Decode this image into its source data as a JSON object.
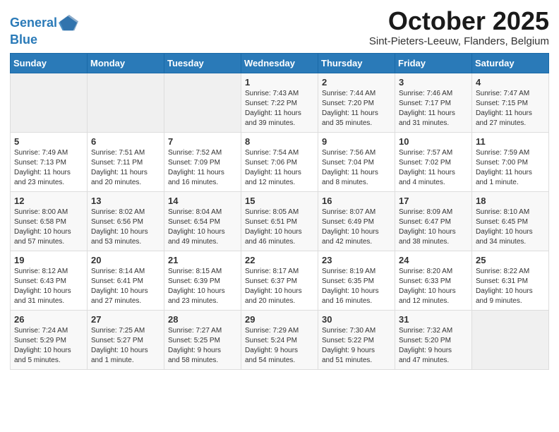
{
  "header": {
    "logo_line1": "General",
    "logo_line2": "Blue",
    "month": "October 2025",
    "location": "Sint-Pieters-Leeuw, Flanders, Belgium"
  },
  "days_of_week": [
    "Sunday",
    "Monday",
    "Tuesday",
    "Wednesday",
    "Thursday",
    "Friday",
    "Saturday"
  ],
  "weeks": [
    [
      {
        "day": "",
        "info": ""
      },
      {
        "day": "",
        "info": ""
      },
      {
        "day": "",
        "info": ""
      },
      {
        "day": "1",
        "info": "Sunrise: 7:43 AM\nSunset: 7:22 PM\nDaylight: 11 hours\nand 39 minutes."
      },
      {
        "day": "2",
        "info": "Sunrise: 7:44 AM\nSunset: 7:20 PM\nDaylight: 11 hours\nand 35 minutes."
      },
      {
        "day": "3",
        "info": "Sunrise: 7:46 AM\nSunset: 7:17 PM\nDaylight: 11 hours\nand 31 minutes."
      },
      {
        "day": "4",
        "info": "Sunrise: 7:47 AM\nSunset: 7:15 PM\nDaylight: 11 hours\nand 27 minutes."
      }
    ],
    [
      {
        "day": "5",
        "info": "Sunrise: 7:49 AM\nSunset: 7:13 PM\nDaylight: 11 hours\nand 23 minutes."
      },
      {
        "day": "6",
        "info": "Sunrise: 7:51 AM\nSunset: 7:11 PM\nDaylight: 11 hours\nand 20 minutes."
      },
      {
        "day": "7",
        "info": "Sunrise: 7:52 AM\nSunset: 7:09 PM\nDaylight: 11 hours\nand 16 minutes."
      },
      {
        "day": "8",
        "info": "Sunrise: 7:54 AM\nSunset: 7:06 PM\nDaylight: 11 hours\nand 12 minutes."
      },
      {
        "day": "9",
        "info": "Sunrise: 7:56 AM\nSunset: 7:04 PM\nDaylight: 11 hours\nand 8 minutes."
      },
      {
        "day": "10",
        "info": "Sunrise: 7:57 AM\nSunset: 7:02 PM\nDaylight: 11 hours\nand 4 minutes."
      },
      {
        "day": "11",
        "info": "Sunrise: 7:59 AM\nSunset: 7:00 PM\nDaylight: 11 hours\nand 1 minute."
      }
    ],
    [
      {
        "day": "12",
        "info": "Sunrise: 8:00 AM\nSunset: 6:58 PM\nDaylight: 10 hours\nand 57 minutes."
      },
      {
        "day": "13",
        "info": "Sunrise: 8:02 AM\nSunset: 6:56 PM\nDaylight: 10 hours\nand 53 minutes."
      },
      {
        "day": "14",
        "info": "Sunrise: 8:04 AM\nSunset: 6:54 PM\nDaylight: 10 hours\nand 49 minutes."
      },
      {
        "day": "15",
        "info": "Sunrise: 8:05 AM\nSunset: 6:51 PM\nDaylight: 10 hours\nand 46 minutes."
      },
      {
        "day": "16",
        "info": "Sunrise: 8:07 AM\nSunset: 6:49 PM\nDaylight: 10 hours\nand 42 minutes."
      },
      {
        "day": "17",
        "info": "Sunrise: 8:09 AM\nSunset: 6:47 PM\nDaylight: 10 hours\nand 38 minutes."
      },
      {
        "day": "18",
        "info": "Sunrise: 8:10 AM\nSunset: 6:45 PM\nDaylight: 10 hours\nand 34 minutes."
      }
    ],
    [
      {
        "day": "19",
        "info": "Sunrise: 8:12 AM\nSunset: 6:43 PM\nDaylight: 10 hours\nand 31 minutes."
      },
      {
        "day": "20",
        "info": "Sunrise: 8:14 AM\nSunset: 6:41 PM\nDaylight: 10 hours\nand 27 minutes."
      },
      {
        "day": "21",
        "info": "Sunrise: 8:15 AM\nSunset: 6:39 PM\nDaylight: 10 hours\nand 23 minutes."
      },
      {
        "day": "22",
        "info": "Sunrise: 8:17 AM\nSunset: 6:37 PM\nDaylight: 10 hours\nand 20 minutes."
      },
      {
        "day": "23",
        "info": "Sunrise: 8:19 AM\nSunset: 6:35 PM\nDaylight: 10 hours\nand 16 minutes."
      },
      {
        "day": "24",
        "info": "Sunrise: 8:20 AM\nSunset: 6:33 PM\nDaylight: 10 hours\nand 12 minutes."
      },
      {
        "day": "25",
        "info": "Sunrise: 8:22 AM\nSunset: 6:31 PM\nDaylight: 10 hours\nand 9 minutes."
      }
    ],
    [
      {
        "day": "26",
        "info": "Sunrise: 7:24 AM\nSunset: 5:29 PM\nDaylight: 10 hours\nand 5 minutes."
      },
      {
        "day": "27",
        "info": "Sunrise: 7:25 AM\nSunset: 5:27 PM\nDaylight: 10 hours\nand 1 minute."
      },
      {
        "day": "28",
        "info": "Sunrise: 7:27 AM\nSunset: 5:25 PM\nDaylight: 9 hours\nand 58 minutes."
      },
      {
        "day": "29",
        "info": "Sunrise: 7:29 AM\nSunset: 5:24 PM\nDaylight: 9 hours\nand 54 minutes."
      },
      {
        "day": "30",
        "info": "Sunrise: 7:30 AM\nSunset: 5:22 PM\nDaylight: 9 hours\nand 51 minutes."
      },
      {
        "day": "31",
        "info": "Sunrise: 7:32 AM\nSunset: 5:20 PM\nDaylight: 9 hours\nand 47 minutes."
      },
      {
        "day": "",
        "info": ""
      }
    ]
  ]
}
